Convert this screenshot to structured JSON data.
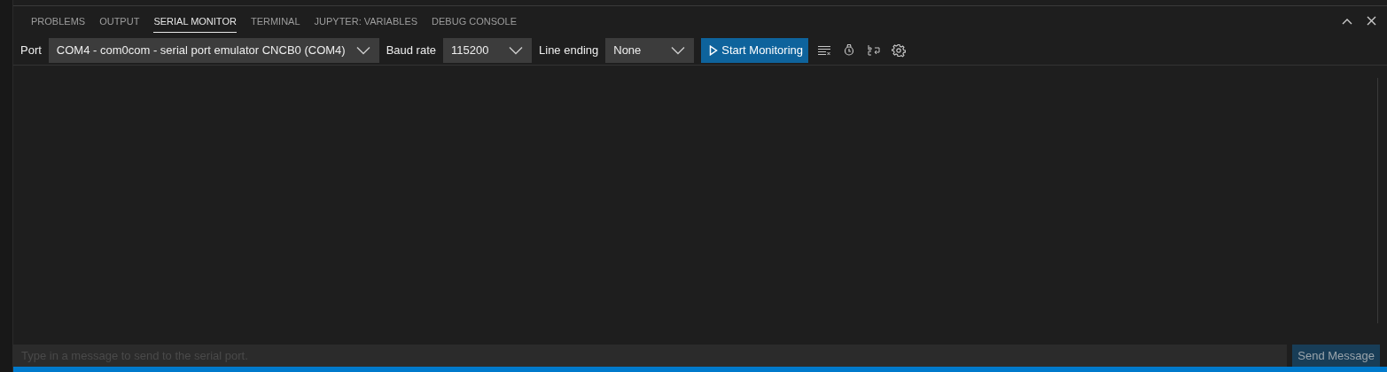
{
  "tabs": [
    {
      "label": "PROBLEMS",
      "selected": false
    },
    {
      "label": "OUTPUT",
      "selected": false
    },
    {
      "label": "SERIAL MONITOR",
      "selected": true
    },
    {
      "label": "TERMINAL",
      "selected": false
    },
    {
      "label": "JUPYTER: VARIABLES",
      "selected": false
    },
    {
      "label": "DEBUG CONSOLE",
      "selected": false
    }
  ],
  "toolbar": {
    "port": {
      "label": "Port",
      "value": "COM4 - com0com - serial port emulator CNCB0 (COM4)"
    },
    "baud_rate": {
      "label": "Baud rate",
      "value": "115200"
    },
    "line_ending": {
      "label": "Line ending",
      "value": "None"
    },
    "start_button": "Start Monitoring"
  },
  "message": {
    "placeholder": "Type in a message to send to the serial port.",
    "send_button": {
      "label": "Send Message",
      "disabled": true
    }
  }
}
